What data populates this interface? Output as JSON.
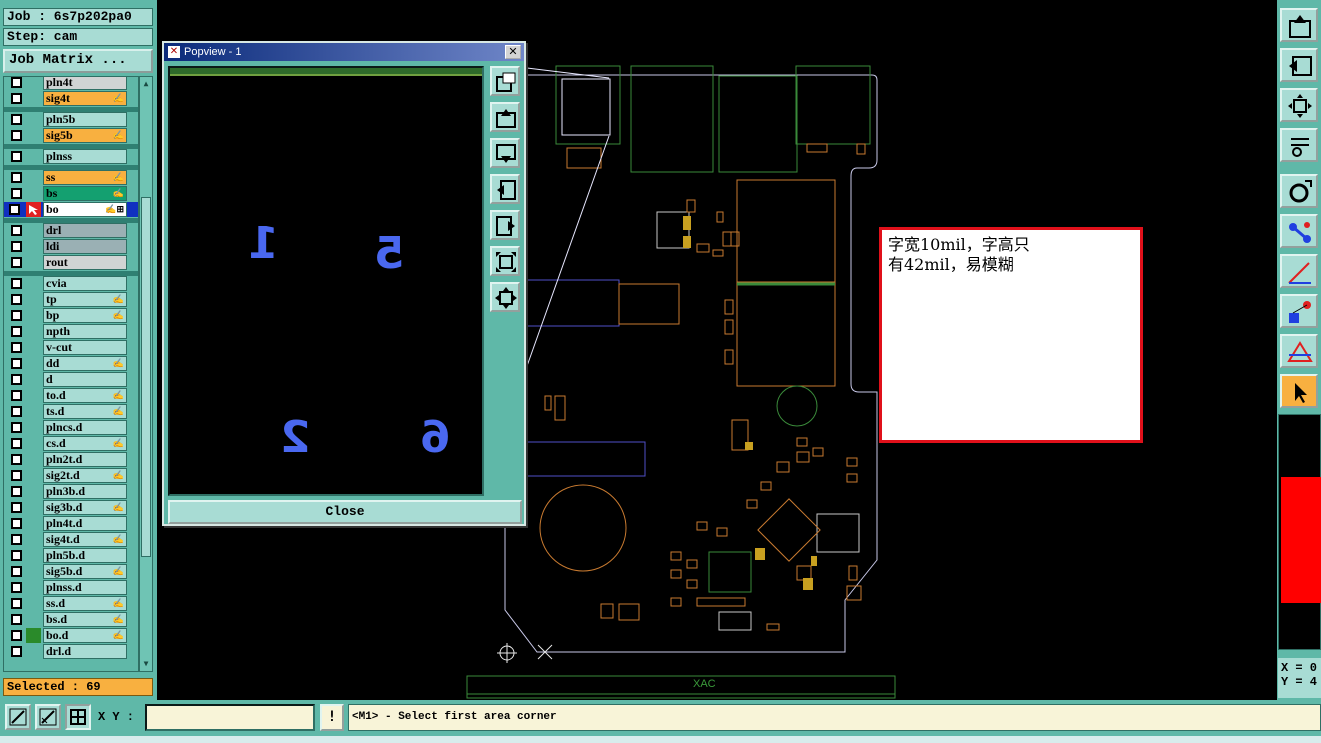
{
  "job": {
    "label": "Job : 6s7p202pa0",
    "step": "Step: cam",
    "matrix_button": "Job Matrix ..."
  },
  "layers": [
    {
      "name": "pln4t",
      "color": "lgrey",
      "flag": ""
    },
    {
      "name": "sig4t",
      "color": "orange",
      "flag": "✍"
    },
    {
      "name": "pln5b",
      "color": "",
      "flag": ""
    },
    {
      "name": "sig5b",
      "color": "orange",
      "flag": "✍"
    },
    {
      "name": "plnss",
      "color": "",
      "flag": ""
    },
    {
      "name": "ss",
      "color": "orange",
      "flag": "✍"
    },
    {
      "name": "bs",
      "color": "green",
      "flag": "✍"
    },
    {
      "name": "bo",
      "color": "white",
      "flag": "✍⊞"
    },
    {
      "name": "drl",
      "color": "grey",
      "flag": ""
    },
    {
      "name": "ldi",
      "color": "grey",
      "flag": ""
    },
    {
      "name": "rout",
      "color": "lgrey",
      "flag": ""
    },
    {
      "name": "cvia",
      "color": "",
      "flag": ""
    },
    {
      "name": "tp",
      "color": "",
      "flag": "✍"
    },
    {
      "name": "bp",
      "color": "",
      "flag": "✍"
    },
    {
      "name": "npth",
      "color": "",
      "flag": ""
    },
    {
      "name": "v-cut",
      "color": "",
      "flag": ""
    },
    {
      "name": "dd",
      "color": "",
      "flag": "✍"
    },
    {
      "name": "d",
      "color": "",
      "flag": ""
    },
    {
      "name": "to.d",
      "color": "",
      "flag": "✍"
    },
    {
      "name": "ts.d",
      "color": "",
      "flag": "✍"
    },
    {
      "name": "plncs.d",
      "color": "",
      "flag": ""
    },
    {
      "name": "cs.d",
      "color": "",
      "flag": "✍"
    },
    {
      "name": "pln2t.d",
      "color": "",
      "flag": ""
    },
    {
      "name": "sig2t.d",
      "color": "",
      "flag": "✍"
    },
    {
      "name": "pln3b.d",
      "color": "",
      "flag": ""
    },
    {
      "name": "sig3b.d",
      "color": "",
      "flag": "✍"
    },
    {
      "name": "pln4t.d",
      "color": "",
      "flag": ""
    },
    {
      "name": "sig4t.d",
      "color": "",
      "flag": "✍"
    },
    {
      "name": "pln5b.d",
      "color": "",
      "flag": ""
    },
    {
      "name": "sig5b.d",
      "color": "",
      "flag": "✍"
    },
    {
      "name": "plnss.d",
      "color": "",
      "flag": ""
    },
    {
      "name": "ss.d",
      "color": "",
      "flag": "✍"
    },
    {
      "name": "bs.d",
      "color": "",
      "flag": "✍"
    },
    {
      "name": "bo.d",
      "color": "",
      "flag": "✍"
    },
    {
      "name": "drl.d",
      "color": "",
      "flag": ""
    }
  ],
  "selected": "Selected : 69",
  "popview": {
    "title": "Popview - 1",
    "digits": [
      "1",
      "5",
      "2",
      "6"
    ],
    "close_label": "Close"
  },
  "annotation": {
    "line1": "字宽10mil，字高只",
    "line2": "有42mil，易模糊"
  },
  "canvas_text": {
    "footer": "XAC"
  },
  "coords": {
    "x": "X = 0",
    "y": "Y = 4"
  },
  "bottom": {
    "xy_label": "X Y :",
    "xy_value": "",
    "excl": "!",
    "status": "<M1> - Select first area corner"
  },
  "colors": {
    "accent_panel": "#5fb8a8",
    "light_panel": "#a8dcd4",
    "highlight": "#f8b040",
    "note_border": "#e0101a"
  },
  "icons": [
    "window-icon",
    "zoom-out-icon",
    "zoom-in-icon",
    "pan-icon",
    "fit-icon",
    "measure-icon",
    "snap-icon",
    "select-icon"
  ]
}
